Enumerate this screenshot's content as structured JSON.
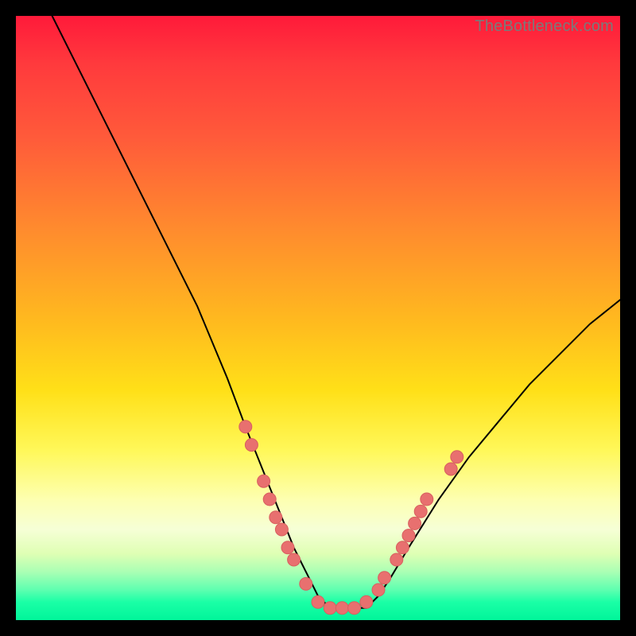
{
  "watermark": "TheBottleneck.com",
  "chart_data": {
    "type": "line",
    "title": "",
    "xlabel": "",
    "ylabel": "",
    "xlim": [
      0,
      100
    ],
    "ylim": [
      0,
      100
    ],
    "series": [
      {
        "name": "curve",
        "x": [
          6,
          10,
          15,
          20,
          25,
          30,
          35,
          38,
          40,
          42,
          44,
          46,
          48,
          50,
          52,
          54,
          56,
          58,
          60,
          62,
          65,
          70,
          75,
          80,
          85,
          90,
          95,
          100
        ],
        "y": [
          100,
          92,
          82,
          72,
          62,
          52,
          40,
          32,
          27,
          22,
          17,
          12,
          8,
          4,
          2,
          2,
          2,
          2,
          4,
          7,
          12,
          20,
          27,
          33,
          39,
          44,
          49,
          53
        ]
      }
    ],
    "markers": [
      {
        "x": 38,
        "y": 32
      },
      {
        "x": 39,
        "y": 29
      },
      {
        "x": 41,
        "y": 23
      },
      {
        "x": 42,
        "y": 20
      },
      {
        "x": 43,
        "y": 17
      },
      {
        "x": 44,
        "y": 15
      },
      {
        "x": 45,
        "y": 12
      },
      {
        "x": 46,
        "y": 10
      },
      {
        "x": 48,
        "y": 6
      },
      {
        "x": 50,
        "y": 3
      },
      {
        "x": 52,
        "y": 2
      },
      {
        "x": 54,
        "y": 2
      },
      {
        "x": 56,
        "y": 2
      },
      {
        "x": 58,
        "y": 3
      },
      {
        "x": 60,
        "y": 5
      },
      {
        "x": 61,
        "y": 7
      },
      {
        "x": 63,
        "y": 10
      },
      {
        "x": 64,
        "y": 12
      },
      {
        "x": 65,
        "y": 14
      },
      {
        "x": 66,
        "y": 16
      },
      {
        "x": 67,
        "y": 18
      },
      {
        "x": 68,
        "y": 20
      },
      {
        "x": 72,
        "y": 25
      },
      {
        "x": 73,
        "y": 27
      }
    ],
    "colors": {
      "curve_stroke": "#000000",
      "marker_fill": "#e8706f",
      "marker_stroke": "#d85f5f"
    }
  }
}
